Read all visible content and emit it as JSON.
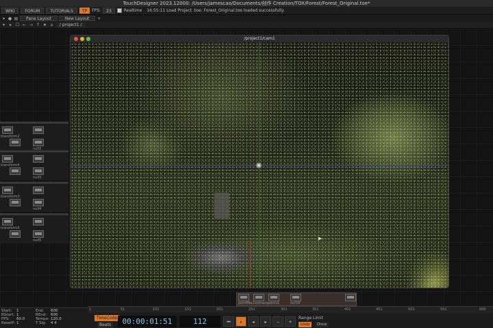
{
  "app": {
    "title": "TouchDesigner 2023.12000: /Users/jamescao/Documents/创作 Creation/TOX/Forest/Forest_Original.toe*"
  },
  "toolbar": {
    "wiki": "WIKI",
    "forum": "FORUM",
    "tutorials": "TUTORIALS",
    "badge": "TP",
    "fps_label": "FPS:",
    "fps_value": "23",
    "realtime_label": "Realtime",
    "status_message": "16:55:11 Load Project .toe: Forest_Original.toe loaded successfully."
  },
  "layout_tabs": {
    "pane_layout": "Pane Layout",
    "new_layout": "New Layout",
    "add": "+"
  },
  "path": {
    "current": "/ project1 /"
  },
  "viewer": {
    "title": "/project1/cam1"
  },
  "network": {
    "groups": [
      {
        "labels": [
          "transform2",
          "null2"
        ]
      },
      {
        "labels": [
          "transform4",
          "null3"
        ]
      },
      {
        "labels": [
          "transform3",
          "null4"
        ]
      },
      {
        "labels": [
          "transform5",
          "null5"
        ]
      }
    ],
    "strip_labels": [
      "pointfile1",
      "extractpoints1",
      "nul14"
    ]
  },
  "timeline": {
    "ticks": [
      "1",
      "51",
      "101",
      "151",
      "201",
      "251",
      "301",
      "351",
      "401",
      "451",
      "501",
      "551",
      "600"
    ]
  },
  "transport": {
    "stats": [
      {
        "k1": "Start:",
        "v1": "1",
        "k2": "End:",
        "v2": "600"
      },
      {
        "k1": "RStart:",
        "v1": "1",
        "k2": "REnd:",
        "v2": "600"
      },
      {
        "k1": "FPS:",
        "v1": "60.0",
        "k2": "Tempo:",
        "v2": "120.0"
      },
      {
        "k1": "ResetF:",
        "v1": "1",
        "k2": "T Sig:",
        "v2": "4   4"
      }
    ],
    "timecode_label": "TimeCode",
    "beats_label": "Beats",
    "timecode": "00:00:01:51",
    "frame": "112",
    "range_limit_label": "Range Limit",
    "loop_label": "Loop",
    "once_label": "Once"
  },
  "colors": {
    "accent": "#d9772a",
    "timecode_text": "#8ec5e8"
  }
}
